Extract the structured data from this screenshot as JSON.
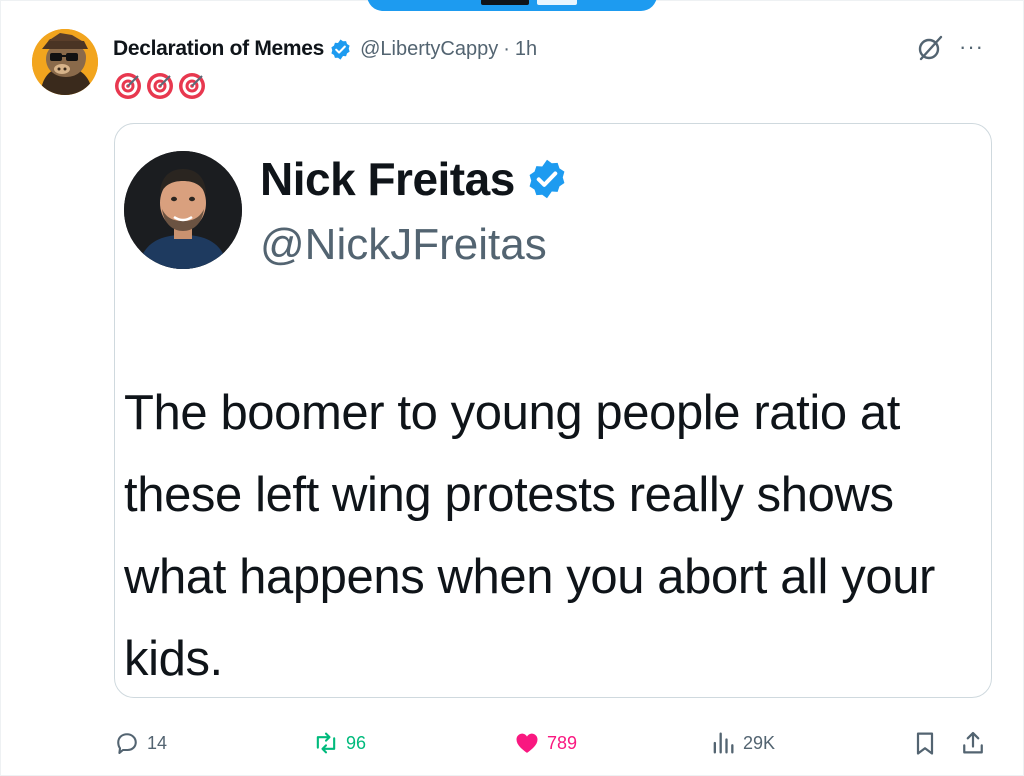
{
  "post": {
    "display_name": "Declaration of Memes",
    "handle": "@LibertyCappy",
    "separator": "·",
    "time": "1h",
    "emoji_text": "🎯🎯🎯",
    "more_label": "···"
  },
  "quoted": {
    "display_name": "Nick Freitas",
    "handle": "@NickJFreitas",
    "text": "The boomer to young people ratio at these left wing protests really shows what happens when you abort all your kids."
  },
  "actions": {
    "replies": "14",
    "reposts": "96",
    "likes": "789",
    "views": "29K"
  },
  "colors": {
    "accent": "#1d9bf0",
    "repost": "#00ba7c",
    "like": "#f91880",
    "secondary_text": "#536471"
  },
  "icons": [
    "verified-badge-icon",
    "target-emoji-icon",
    "grok-icon",
    "more-icon",
    "reply-icon",
    "repost-icon",
    "like-icon",
    "views-icon",
    "bookmark-icon",
    "share-icon"
  ]
}
